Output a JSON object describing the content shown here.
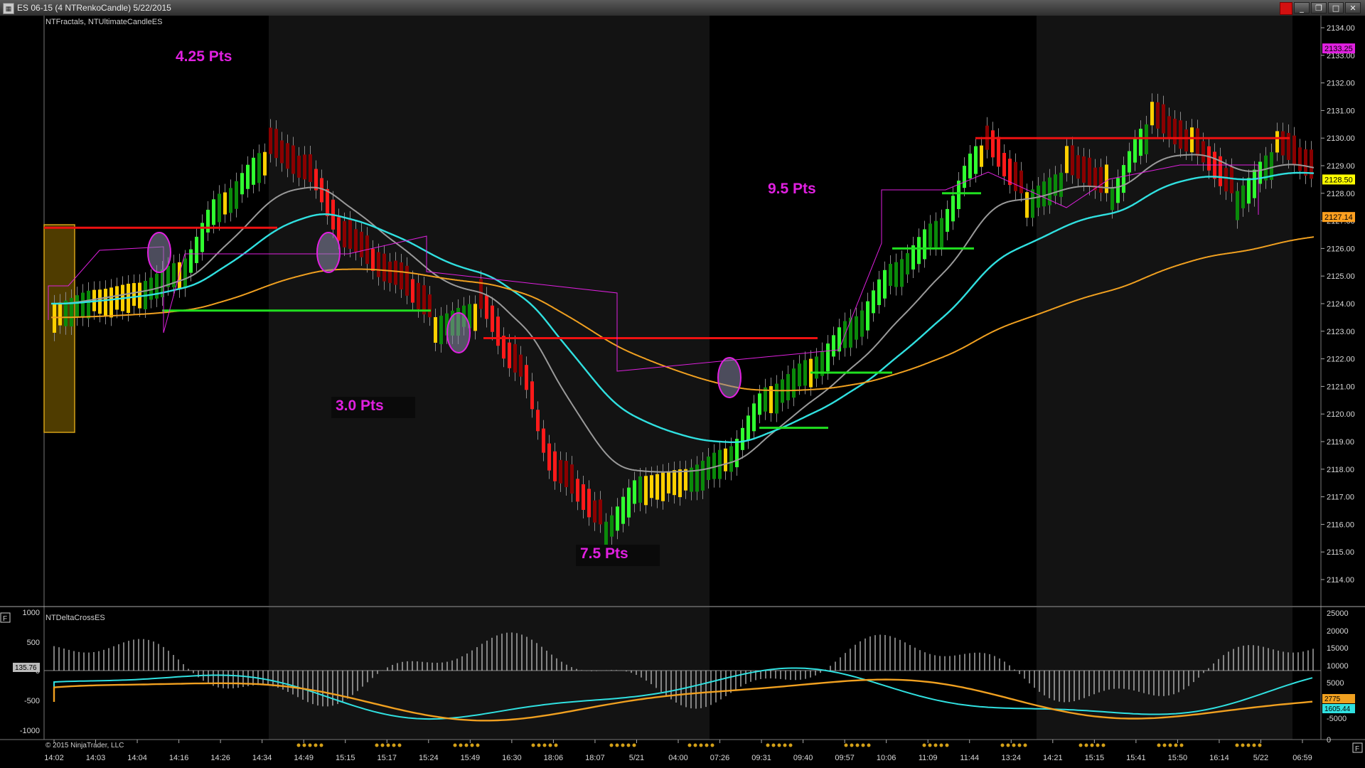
{
  "window": {
    "title": "ES 06-15 (4 NTRenkoCandle)  5/22/2015",
    "buttons": {
      "minimize": "_",
      "restore": "❐",
      "maximize": "□",
      "close": "✕"
    }
  },
  "price_panel": {
    "indicator_label": "NTFractals, NTUltimateCandleES",
    "price_ticks": [
      "2134.00",
      "2133.00",
      "2132.00",
      "2131.00",
      "2130.00",
      "2129.00",
      "2128.00",
      "2127.00",
      "2126.00",
      "2125.00",
      "2124.00",
      "2123.00",
      "2122.00",
      "2121.00",
      "2120.00",
      "2119.00",
      "2118.00",
      "2117.00",
      "2116.00",
      "2115.00",
      "2114.00"
    ],
    "price_badges": [
      {
        "label": "2133.25",
        "color": "#e020e0"
      },
      {
        "label": "2128.50",
        "color": "#ffff00"
      },
      {
        "label": "2127.14",
        "color": "#ffa020"
      }
    ],
    "annotations": [
      "4.25 Pts",
      "3.0 Pts",
      "7.5 Pts",
      "9.5 Pts"
    ]
  },
  "lower_panel": {
    "indicator_label": "NTDeltaCrossES",
    "left_ticks": [
      "1000",
      "500",
      "0",
      "-500",
      "-1000"
    ],
    "right_ticks": [
      "25000",
      "20000",
      "15000",
      "10000",
      "5000",
      "-5000",
      "0"
    ],
    "left_badge": "135.76",
    "right_badges": [
      "2775",
      "1605.44"
    ],
    "copyright": "© 2015 NinjaTrader, LLC"
  },
  "time_axis": [
    "14:02",
    "14:03",
    "14:04",
    "14:16",
    "14:26",
    "14:34",
    "14:49",
    "15:15",
    "15:17",
    "15:24",
    "15:49",
    "16:30",
    "18:06",
    "18:07",
    "5/21",
    "04:00",
    "07:26",
    "09:31",
    "09:40",
    "09:57",
    "10:06",
    "11:09",
    "11:44",
    "13:24",
    "14:21",
    "15:15",
    "15:41",
    "15:50",
    "16:14",
    "5/22",
    "06:59"
  ],
  "colors": {
    "background": "#000000",
    "session_shade": "#131313",
    "bull_bright": "#30ff30",
    "bull_dark": "#0a8a0a",
    "bear_bright": "#ff1a1a",
    "bear_dark": "#8a0000",
    "neutral": "#ffd000",
    "gray_line": "#9a9a9a",
    "cyan_line": "#30e0e0",
    "orange_line": "#f0a020",
    "magenta": "#e020e0",
    "support_green": "#20e020",
    "resistance_red": "#ee1111"
  },
  "chart_data": {
    "type": "candlestick",
    "title": "ES 06-15 (4 NTRenkoCandle)  5/22/2015",
    "y_range": [
      2113.5,
      2134.25
    ],
    "x": [
      "14:02",
      "14:03",
      "14:04",
      "14:16",
      "14:26",
      "14:34",
      "14:49",
      "15:15",
      "15:17",
      "15:24",
      "15:49",
      "16:30",
      "18:06",
      "18:07",
      "5/21",
      "04:00",
      "07:26",
      "09:31",
      "09:40",
      "09:57",
      "10:06",
      "11:09",
      "11:44",
      "13:24",
      "14:21",
      "15:15",
      "15:41",
      "15:50",
      "16:14",
      "5/22",
      "06:59"
    ],
    "close_path": [
      2124.0,
      2124.5,
      2124.75,
      2125.5,
      2128.0,
      2129.5,
      2128.5,
      2126.0,
      2124.75,
      2123.5,
      2124.0,
      2121.5,
      2117.5,
      2116.0,
      2117.75,
      2118.0,
      2118.75,
      2121.0,
      2122.0,
      2123.5,
      2125.5,
      2127.0,
      2129.75,
      2128.0,
      2128.75,
      2128.0,
      2130.5,
      2129.5,
      2128.0,
      2129.5,
      2128.5
    ],
    "last_price": 2128.5,
    "annotations": [
      "4.25 Pts",
      "3.0 Pts",
      "7.5 Pts",
      "9.5 Pts"
    ]
  }
}
